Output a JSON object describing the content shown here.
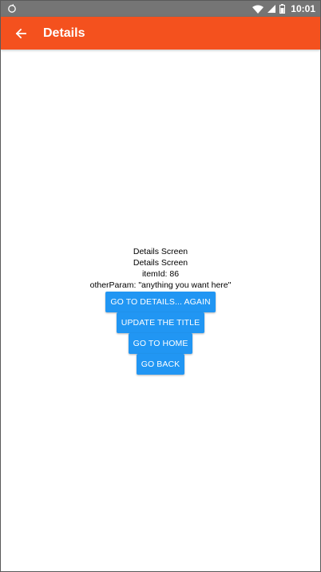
{
  "status_bar": {
    "time": "10:01",
    "icons": [
      "sync-icon",
      "wifi-icon",
      "signal-icon",
      "battery-icon"
    ]
  },
  "app_bar": {
    "title": "Details",
    "back_icon": "arrow-left-icon",
    "color": "#f4511e"
  },
  "content": {
    "title_line_1": "Details Screen",
    "title_line_2": "Details Screen",
    "item_id": "itemId: 86",
    "other_param": "otherParam: \"anything you want here\""
  },
  "buttons": {
    "go_to_details_again": "GO TO DETAILS... AGAIN",
    "update_title": "UPDATE THE TITLE",
    "go_to_home": "GO TO HOME",
    "go_back": "GO BACK",
    "color": "#2196f3"
  }
}
